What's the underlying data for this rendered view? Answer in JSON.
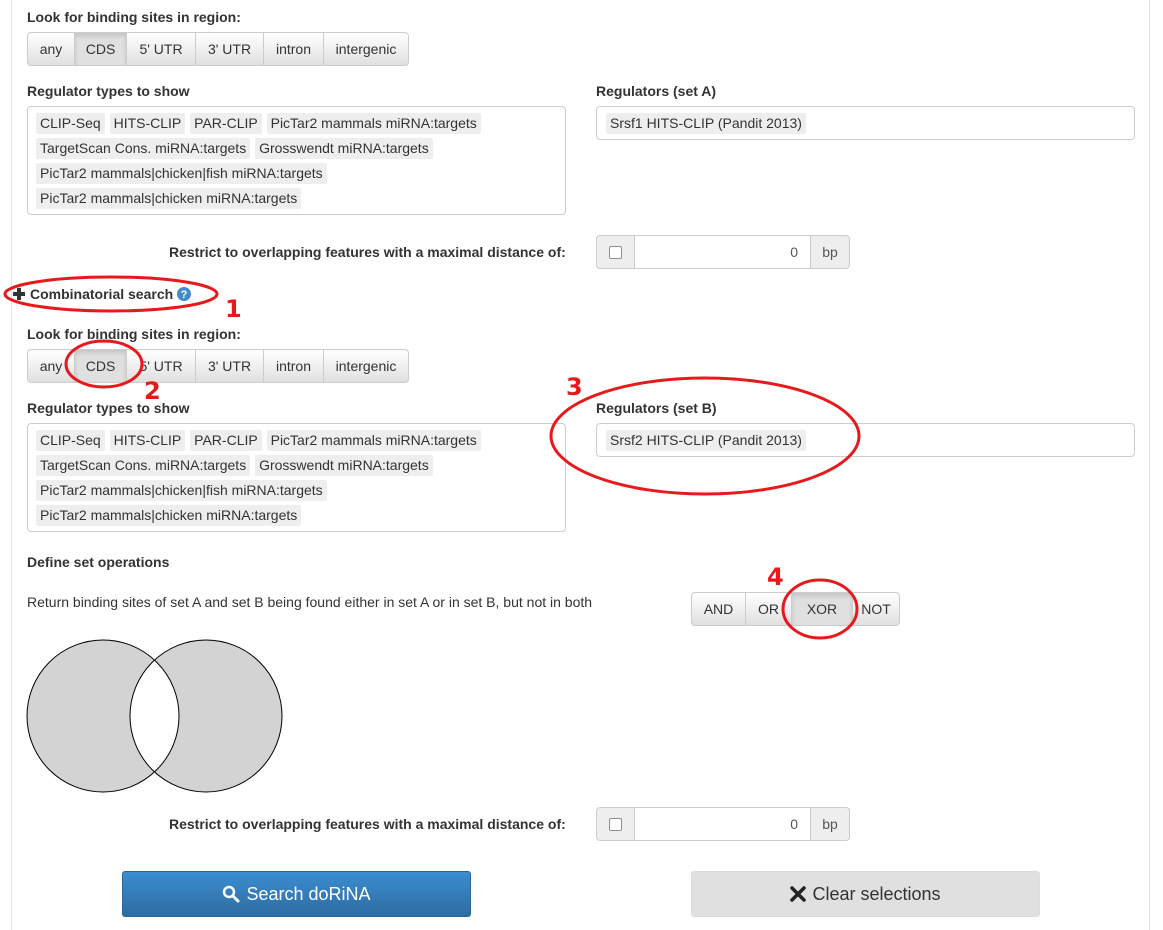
{
  "section_a": {
    "region_label": "Look for binding sites in region:",
    "region_options": [
      "any",
      "CDS",
      "5' UTR",
      "3' UTR",
      "intron",
      "intergenic"
    ],
    "region_selected": "CDS",
    "types_label": "Regulator types to show",
    "types": [
      "CLIP-Seq",
      "HITS-CLIP",
      "PAR-CLIP",
      "PicTar2 mammals miRNA:targets",
      "TargetScan Cons. miRNA:targets",
      "Grosswendt miRNA:targets",
      "PicTar2 mammals|chicken|fish miRNA:targets",
      "PicTar2 mammals|chicken miRNA:targets"
    ],
    "regulators_label": "Regulators (set A)",
    "regulator_value": "Srsf1 HITS-CLIP (Pandit 2013)",
    "restrict_label": "Restrict to overlapping features with a maximal distance of:",
    "distance_value": "0",
    "distance_unit": "bp"
  },
  "combinatorial": {
    "icon": "plus-icon",
    "label": "Combinatorial search",
    "help_icon": "help-icon"
  },
  "section_b": {
    "region_label": "Look for binding sites in region:",
    "region_options": [
      "any",
      "CDS",
      "5' UTR",
      "3' UTR",
      "intron",
      "intergenic"
    ],
    "region_selected": "CDS",
    "types_label": "Regulator types to show",
    "types": [
      "CLIP-Seq",
      "HITS-CLIP",
      "PAR-CLIP",
      "PicTar2 mammals miRNA:targets",
      "TargetScan Cons. miRNA:targets",
      "Grosswendt miRNA:targets",
      "PicTar2 mammals|chicken|fish miRNA:targets",
      "PicTar2 mammals|chicken miRNA:targets"
    ],
    "regulators_label": "Regulators (set B)",
    "regulator_value": "Srsf2 HITS-CLIP (Pandit 2013)"
  },
  "set_operations": {
    "label": "Define set operations",
    "description": "Return binding sites of set A and set B being found either in set A or in set B, but not in both",
    "options": [
      "AND",
      "OR",
      "XOR",
      "NOT"
    ],
    "selected": "XOR",
    "venn_fill": "#d3d3d3",
    "restrict_label": "Restrict to overlapping features with a maximal distance of:",
    "distance_value": "0",
    "distance_unit": "bp"
  },
  "actions": {
    "search_label": "Search doRiNA",
    "search_icon": "search-icon",
    "clear_label": "Clear selections",
    "clear_icon": "close-icon"
  },
  "annotations": {
    "color": "#e8191c",
    "labels": [
      "1",
      "2",
      "3",
      "4"
    ]
  }
}
